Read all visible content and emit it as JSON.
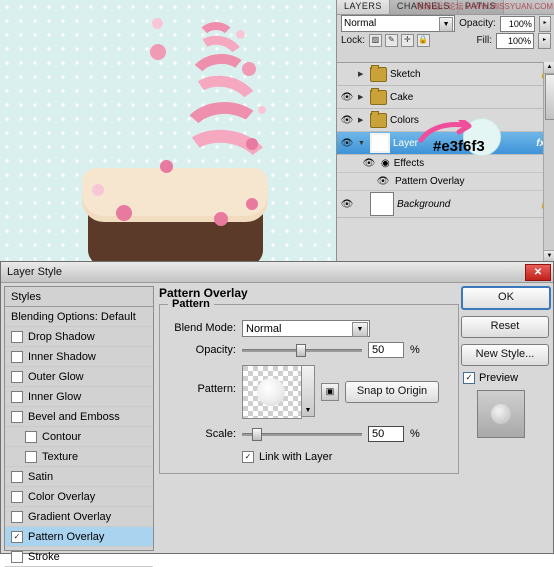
{
  "canvas": {
    "name": "cake-artwork-canvas",
    "bg_color": "#d9f0ee"
  },
  "layers_panel": {
    "tabs": [
      {
        "label": "LAYERS",
        "active": true
      },
      {
        "label": "CHANNELS",
        "active": false
      },
      {
        "label": "PATHS",
        "active": false
      }
    ],
    "watermark": "思缘设计论坛  WWW.MISSYUAN.COM",
    "blend_mode": "Normal",
    "opacity_label": "Opacity:",
    "opacity_value": "100%",
    "lock_label": "Lock:",
    "lock_icons": [
      "transparency-lock",
      "brush-lock",
      "move-lock",
      "all-lock"
    ],
    "fill_label": "Fill:",
    "fill_value": "100%",
    "callout_hex": "#e3f6f3",
    "layers": [
      {
        "name": "Sketch",
        "type": "group",
        "visible": false,
        "locked": true,
        "expanded": false,
        "selected": false,
        "fx": false
      },
      {
        "name": "Cake",
        "type": "group",
        "visible": true,
        "locked": false,
        "expanded": false,
        "selected": false,
        "fx": false
      },
      {
        "name": "Colors",
        "type": "group",
        "visible": true,
        "locked": false,
        "expanded": false,
        "selected": false,
        "fx": false
      },
      {
        "name": "Layer",
        "type": "layer",
        "visible": true,
        "locked": false,
        "expanded": true,
        "selected": true,
        "fx": true
      },
      {
        "name": "Effects",
        "type": "effects",
        "visible": true,
        "selected": false
      },
      {
        "name": "Pattern Overlay",
        "type": "effect-item",
        "visible": true,
        "selected": false
      },
      {
        "name": "Background",
        "type": "layer",
        "visible": true,
        "locked": true,
        "selected": false,
        "fx": false
      }
    ]
  },
  "dialog": {
    "title": "Layer Style",
    "close_label": "✕",
    "styles_header": "Styles",
    "styles": [
      {
        "label": "Blending Options: Default",
        "checkbox": false,
        "checked": false,
        "sub": false,
        "selected": false
      },
      {
        "label": "Drop Shadow",
        "checkbox": true,
        "checked": false,
        "sub": false,
        "selected": false
      },
      {
        "label": "Inner Shadow",
        "checkbox": true,
        "checked": false,
        "sub": false,
        "selected": false
      },
      {
        "label": "Outer Glow",
        "checkbox": true,
        "checked": false,
        "sub": false,
        "selected": false
      },
      {
        "label": "Inner Glow",
        "checkbox": true,
        "checked": false,
        "sub": false,
        "selected": false
      },
      {
        "label": "Bevel and Emboss",
        "checkbox": true,
        "checked": false,
        "sub": false,
        "selected": false
      },
      {
        "label": "Contour",
        "checkbox": true,
        "checked": false,
        "sub": true,
        "selected": false
      },
      {
        "label": "Texture",
        "checkbox": true,
        "checked": false,
        "sub": true,
        "selected": false
      },
      {
        "label": "Satin",
        "checkbox": true,
        "checked": false,
        "sub": false,
        "selected": false
      },
      {
        "label": "Color Overlay",
        "checkbox": true,
        "checked": false,
        "sub": false,
        "selected": false
      },
      {
        "label": "Gradient Overlay",
        "checkbox": true,
        "checked": false,
        "sub": false,
        "selected": false
      },
      {
        "label": "Pattern Overlay",
        "checkbox": true,
        "checked": true,
        "sub": false,
        "selected": true
      },
      {
        "label": "Stroke",
        "checkbox": true,
        "checked": false,
        "sub": false,
        "selected": false
      }
    ],
    "section_title": "Pattern Overlay",
    "section_legend": "Pattern",
    "fields": {
      "blend_mode_label": "Blend Mode:",
      "blend_mode_value": "Normal",
      "opacity_label": "Opacity:",
      "opacity_value": "50",
      "opacity_unit": "%",
      "pattern_label": "Pattern:",
      "snap_button": "Snap to Origin",
      "scale_label": "Scale:",
      "scale_value": "50",
      "scale_unit": "%",
      "link_label": "Link with Layer",
      "link_checked": true
    },
    "buttons": {
      "ok": "OK",
      "reset": "Reset",
      "new_style": "New Style...",
      "preview_label": "Preview",
      "preview_checked": true
    }
  }
}
